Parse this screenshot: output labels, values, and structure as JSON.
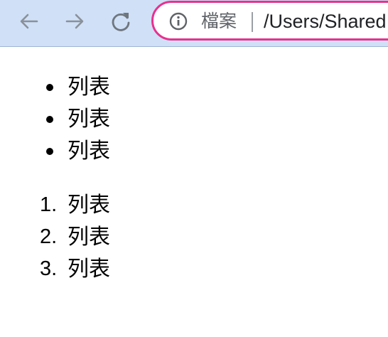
{
  "toolbar": {
    "back_icon": "arrow-left-icon",
    "forward_icon": "arrow-right-icon",
    "reload_icon": "reload-icon",
    "accent_color": "#e8318f",
    "background_color": "#cfe0f7"
  },
  "omnibox": {
    "info_icon": "info-icon",
    "site_label": "檔案",
    "url": "/Users/Shared"
  },
  "page": {
    "unordered_list": [
      {
        "text": "列表"
      },
      {
        "text": "列表"
      },
      {
        "text": "列表"
      }
    ],
    "ordered_list": [
      {
        "number": "1.",
        "text": "列表"
      },
      {
        "number": "2.",
        "text": "列表"
      },
      {
        "number": "3.",
        "text": "列表"
      }
    ]
  }
}
